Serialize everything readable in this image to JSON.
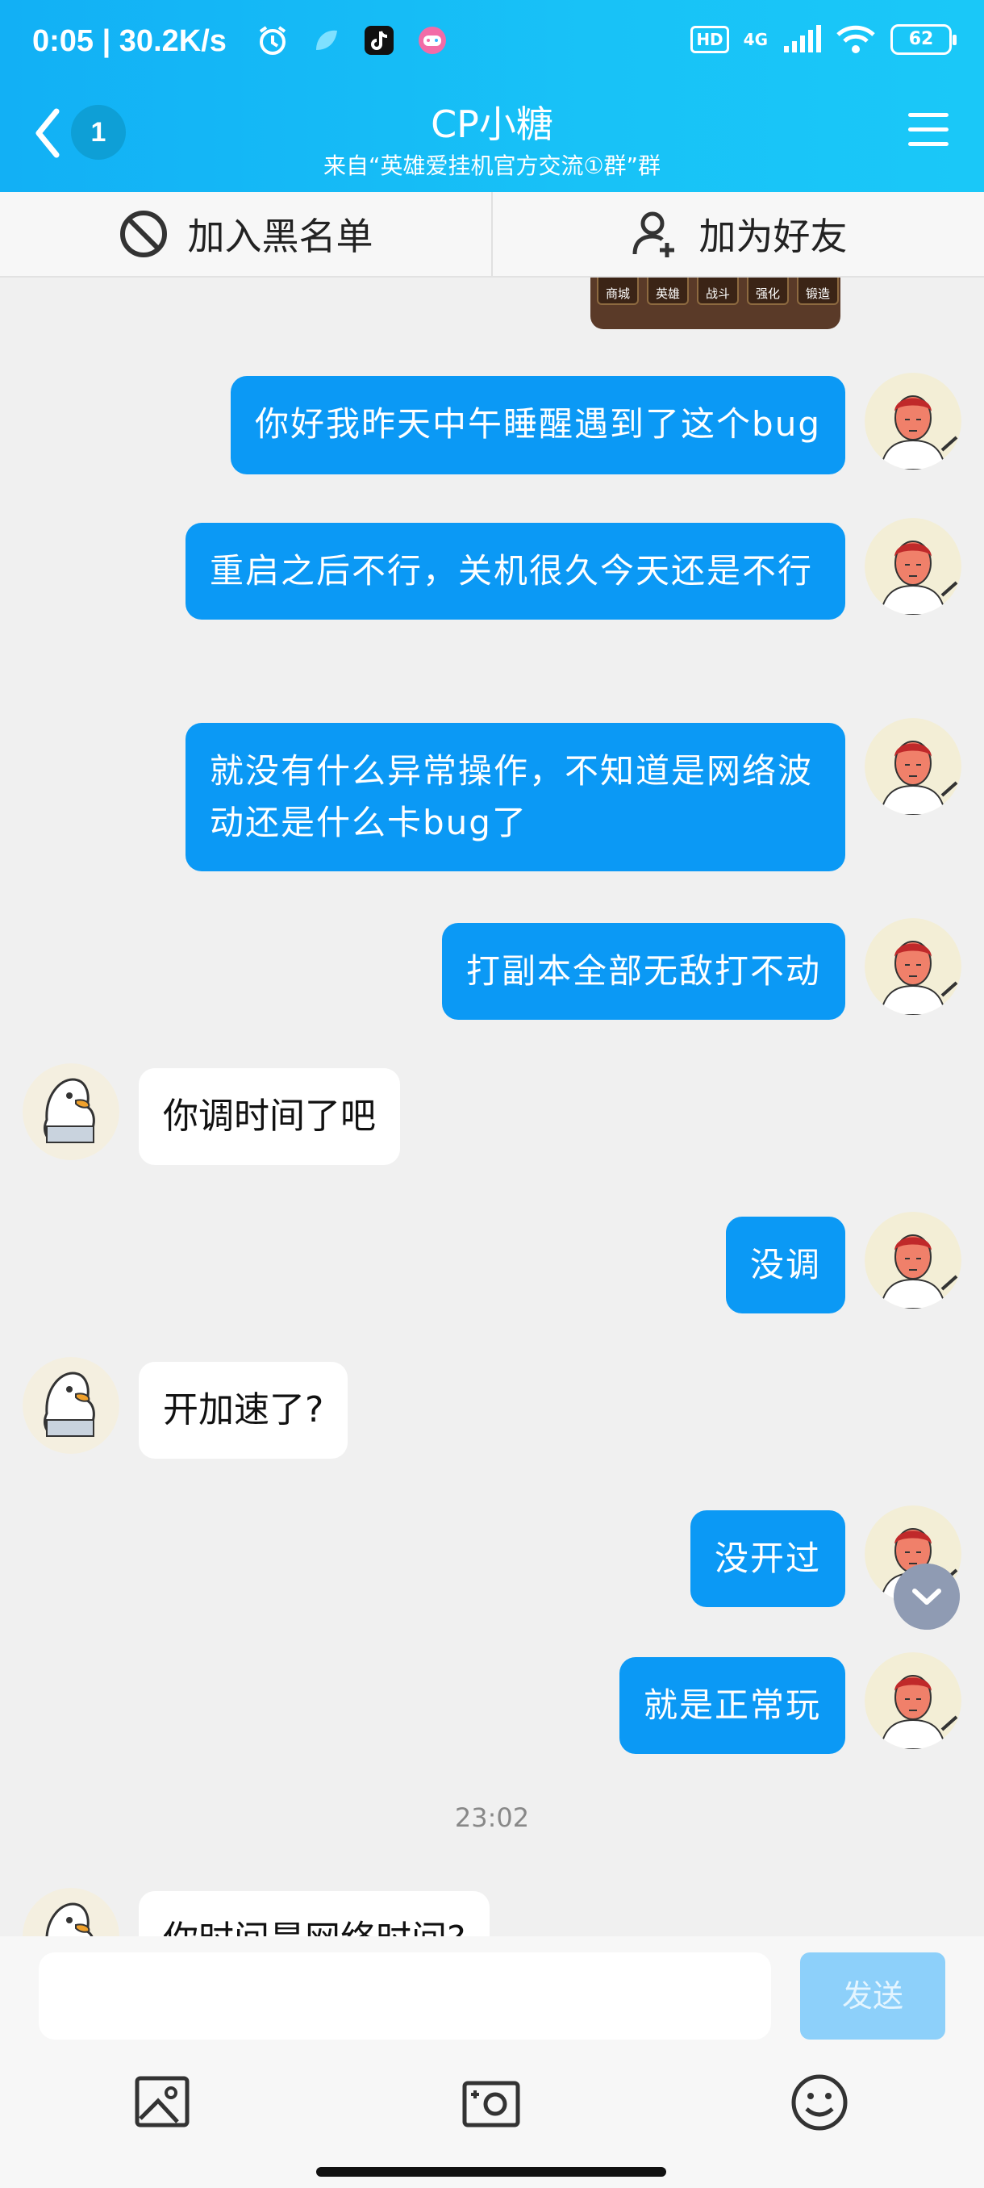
{
  "status_bar": {
    "time": "0:05 | 30.2K/s",
    "network": "4G",
    "hd": "HD",
    "battery": "62"
  },
  "header": {
    "back_badge": "1",
    "title": "CP小糖",
    "subtitle": "来自“英雄爱挂机官方交流①群”群"
  },
  "actions": {
    "blacklist": "加入黑名单",
    "add_friend": "加为好友"
  },
  "game_thumb_labels": [
    "商城",
    "英雄",
    "战斗",
    "强化",
    "锻造"
  ],
  "messages": [
    {
      "from": "me",
      "text": "你好我昨天中午睡醒遇到了这个bug"
    },
    {
      "from": "me",
      "text": "重启之后不行，关机很久今天还是不行"
    },
    {
      "from": "me",
      "text": "就没有什么异常操作，不知道是网络波动还是什么卡bug了"
    },
    {
      "from": "me",
      "text": "打副本全部无敌打不动"
    },
    {
      "from": "them",
      "text": "你调时间了吧"
    },
    {
      "from": "me",
      "text": "没调"
    },
    {
      "from": "them",
      "text": "开加速了?"
    },
    {
      "from": "me",
      "text": "没开过"
    },
    {
      "from": "me",
      "text": "就是正常玩"
    },
    {
      "from": "them",
      "text": "你时间是网络时间?"
    }
  ],
  "timestamp": "23:02",
  "input": {
    "placeholder": "",
    "send_label": "发送"
  },
  "colors": {
    "header": "#12b0f5",
    "bubble_out": "#0b99f5",
    "bubble_in": "#ffffff",
    "send_disabled": "#8dd0fa"
  }
}
